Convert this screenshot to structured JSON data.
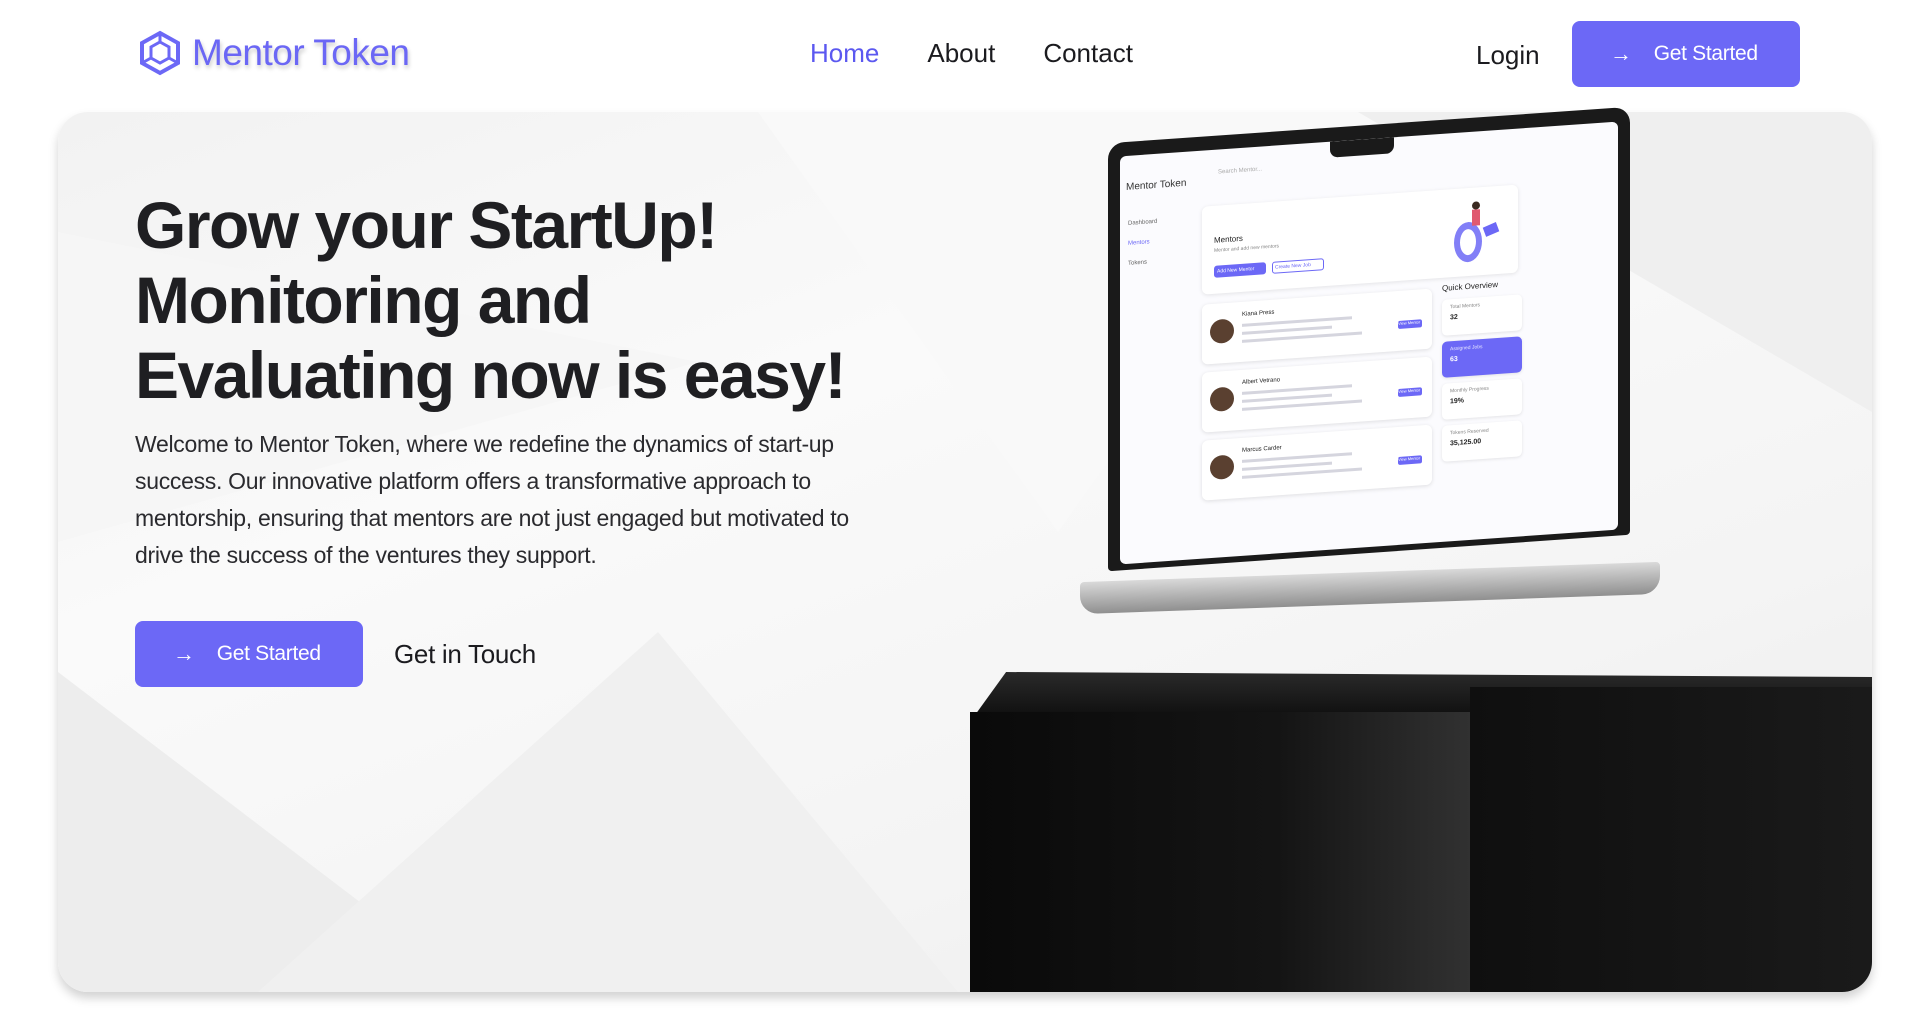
{
  "brand": {
    "name": "Mentor Token",
    "accent_color": "#6c68f6",
    "logo_icon": "hexagon-logo-icon"
  },
  "nav": {
    "items": [
      {
        "label": "Home",
        "active": true
      },
      {
        "label": "About",
        "active": false
      },
      {
        "label": "Contact",
        "active": false
      }
    ],
    "login_label": "Login",
    "cta_label": "Get Started",
    "cta_icon": "arrow-right-icon"
  },
  "hero": {
    "headline": [
      "Grow your StartUp!",
      "Monitoring and",
      "Evaluating now is easy!"
    ],
    "description": "Welcome to Mentor Token, where we redefine the dynamics of start-up success. Our innovative platform offers a transformative approach to mentorship, ensuring that mentors are not just engaged but motivated to drive the success of the ventures they support.",
    "primary_cta": "Get Started",
    "secondary_cta": "Get in Touch"
  },
  "mockup": {
    "logo": "Mentor Token",
    "search_placeholder": "Search Mentor...",
    "sidebar": [
      "Dashboard",
      "Mentors",
      "Tokens"
    ],
    "banner_title": "Mentors",
    "banner_subtitle": "Mentor and add new mentors",
    "banner_primary": "Add New Mentor",
    "banner_secondary": "Create New Job",
    "quick_overview": "Quick Overview",
    "stats": [
      {
        "label": "Total Mentors",
        "value": "32"
      },
      {
        "label": "Assigned Jobs",
        "value": "63"
      },
      {
        "label": "Monthly Progress",
        "value": "19%"
      },
      {
        "label": "Tokens Reserved",
        "value": "35,125.00"
      }
    ],
    "mentors": [
      "Kiana Press",
      "Albert Vetrano",
      "Marcus Carder"
    ],
    "view_label": "View Mentor"
  }
}
